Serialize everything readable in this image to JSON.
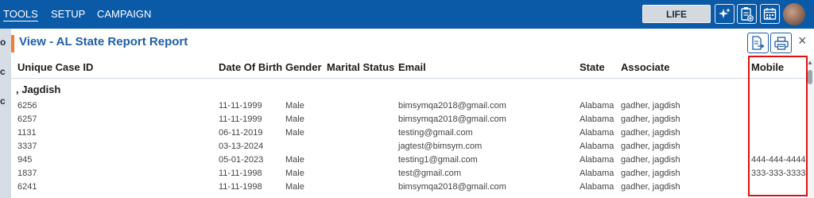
{
  "nav": {
    "tools": "TOOLS",
    "setup": "SETUP",
    "campaign": "CAMPAIGN"
  },
  "header": {
    "product": "LIFE"
  },
  "left_strip": {
    "chars": [
      "o",
      "c",
      "c"
    ]
  },
  "panel": {
    "title": "View - AL State Report Report",
    "close_label": "×"
  },
  "columns": [
    "Unique Case ID",
    "Date Of Birth",
    "Gender",
    "Marital Status",
    "Email",
    "State",
    "Associate",
    "Mobile"
  ],
  "group": {
    "label": ", Jagdish"
  },
  "rows": [
    {
      "id": "6256",
      "dob": "11-11-1999",
      "gender": "Male",
      "marital": "",
      "email": "bimsymqa2018@gmail.com",
      "state": "Alabama",
      "associate": "gadher, jagdish",
      "mobile": ""
    },
    {
      "id": "6257",
      "dob": "11-11-1999",
      "gender": "Male",
      "marital": "",
      "email": "bimsymqa2018@gmail.com",
      "state": "Alabama",
      "associate": "gadher, jagdish",
      "mobile": ""
    },
    {
      "id": "1131",
      "dob": "06-11-2019",
      "gender": "Male",
      "marital": "",
      "email": "testing@gmail.com",
      "state": "Alabama",
      "associate": "gadher, jagdish",
      "mobile": ""
    },
    {
      "id": "3337",
      "dob": "03-13-2024",
      "gender": "",
      "marital": "",
      "email": "jagtest@bimsym.com",
      "state": "Alabama",
      "associate": "gadher, jagdish",
      "mobile": ""
    },
    {
      "id": "945",
      "dob": "05-01-2023",
      "gender": "Male",
      "marital": "",
      "email": "testing1@gmail.com",
      "state": "Alabama",
      "associate": "gadher, jagdish",
      "mobile": "444-444-4444"
    },
    {
      "id": "1837",
      "dob": "11-11-1998",
      "gender": "Male",
      "marital": "",
      "email": "test@gmail.com",
      "state": "Alabama",
      "associate": "gadher, jagdish",
      "mobile": "333-333-3333"
    },
    {
      "id": "6241",
      "dob": "11-11-1998",
      "gender": "Male",
      "marital": "",
      "email": "bimsymqa2018@gmail.com",
      "state": "Alabama",
      "associate": "gadher, jagdish",
      "mobile": ""
    }
  ],
  "colors": {
    "topbar": "#0b5aa8",
    "accent": "#f07d33",
    "title": "#1f5ea8",
    "highlight": "#e01010"
  }
}
